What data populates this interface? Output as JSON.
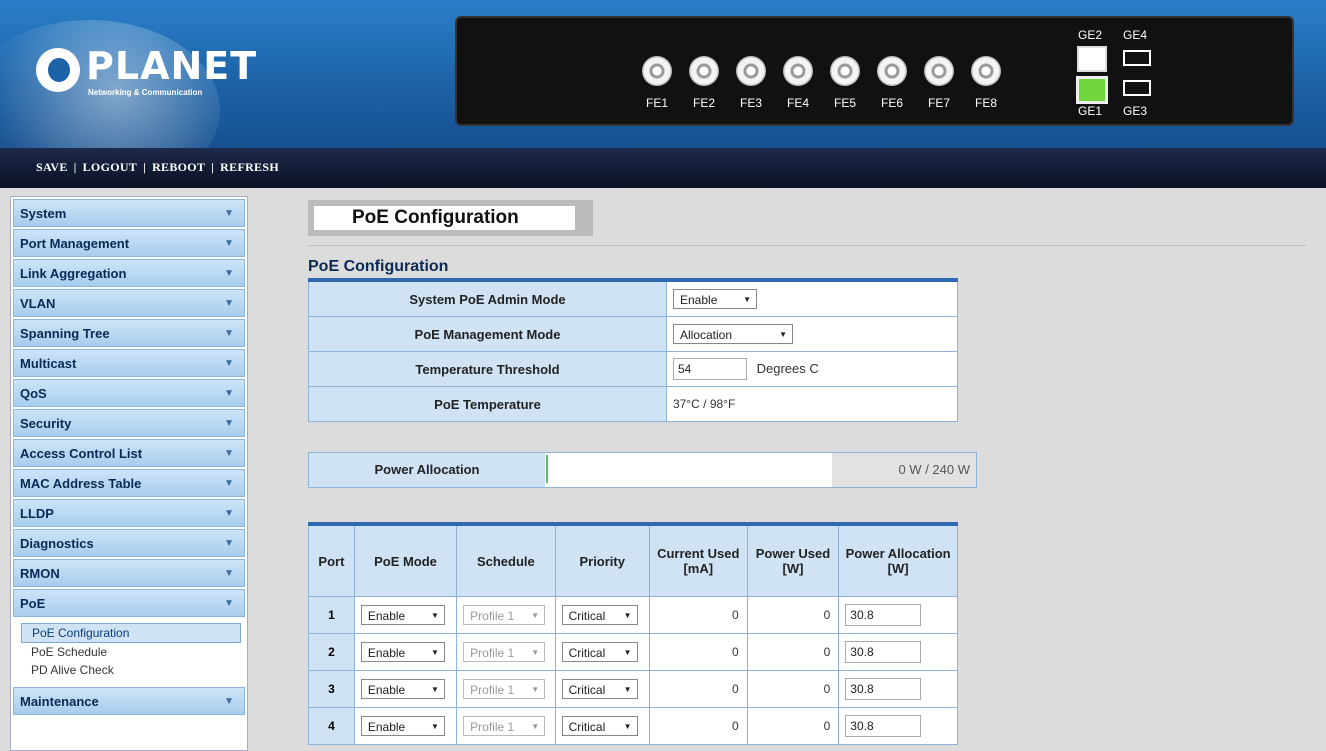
{
  "brand": {
    "name": "PLANET",
    "tagline": "Networking & Communication"
  },
  "device_ports": {
    "fe": [
      "FE1",
      "FE2",
      "FE3",
      "FE4",
      "FE5",
      "FE6",
      "FE7",
      "FE8"
    ],
    "ge": [
      "GE2",
      "GE4",
      "GE1",
      "GE3"
    ]
  },
  "toolbar": {
    "save": "SAVE",
    "logout": "LOGOUT",
    "reboot": "REBOOT",
    "refresh": "REFRESH"
  },
  "sidebar": {
    "items": [
      "System",
      "Port Management",
      "Link Aggregation",
      "VLAN",
      "Spanning Tree",
      "Multicast",
      "QoS",
      "Security",
      "Access Control List",
      "MAC Address Table",
      "LLDP",
      "Diagnostics",
      "RMON",
      "PoE"
    ],
    "poe_sub": [
      "PoE Configuration",
      "PoE Schedule",
      "PD Alive Check"
    ],
    "last": "Maintenance"
  },
  "page": {
    "title": "PoE Configuration",
    "section": "PoE Configuration"
  },
  "config": {
    "admin_mode_label": "System PoE Admin Mode",
    "admin_mode_value": "Enable",
    "mgmt_mode_label": "PoE Management Mode",
    "mgmt_mode_value": "Allocation",
    "temp_threshold_label": "Temperature Threshold",
    "temp_threshold_value": "54",
    "temp_unit": "Degrees C",
    "temperature_label": "PoE Temperature",
    "temperature_value": "37°C / 98°F"
  },
  "allocation": {
    "label": "Power Allocation",
    "value": "0 W / 240 W",
    "fraction": 0.0
  },
  "port_table": {
    "headers": [
      "Port",
      "PoE Mode",
      "Schedule",
      "Priority",
      "Current Used [mA]",
      "Power Used [W]",
      "Power Allocation [W]"
    ],
    "rows": [
      {
        "port": "1",
        "mode": "Enable",
        "schedule": "Profile 1",
        "priority": "Critical",
        "current": "0",
        "power": "0",
        "alloc": "30.8"
      },
      {
        "port": "2",
        "mode": "Enable",
        "schedule": "Profile 1",
        "priority": "Critical",
        "current": "0",
        "power": "0",
        "alloc": "30.8"
      },
      {
        "port": "3",
        "mode": "Enable",
        "schedule": "Profile 1",
        "priority": "Critical",
        "current": "0",
        "power": "0",
        "alloc": "30.8"
      },
      {
        "port": "4",
        "mode": "Enable",
        "schedule": "Profile 1",
        "priority": "Critical",
        "current": "0",
        "power": "0",
        "alloc": "30.8"
      }
    ]
  }
}
